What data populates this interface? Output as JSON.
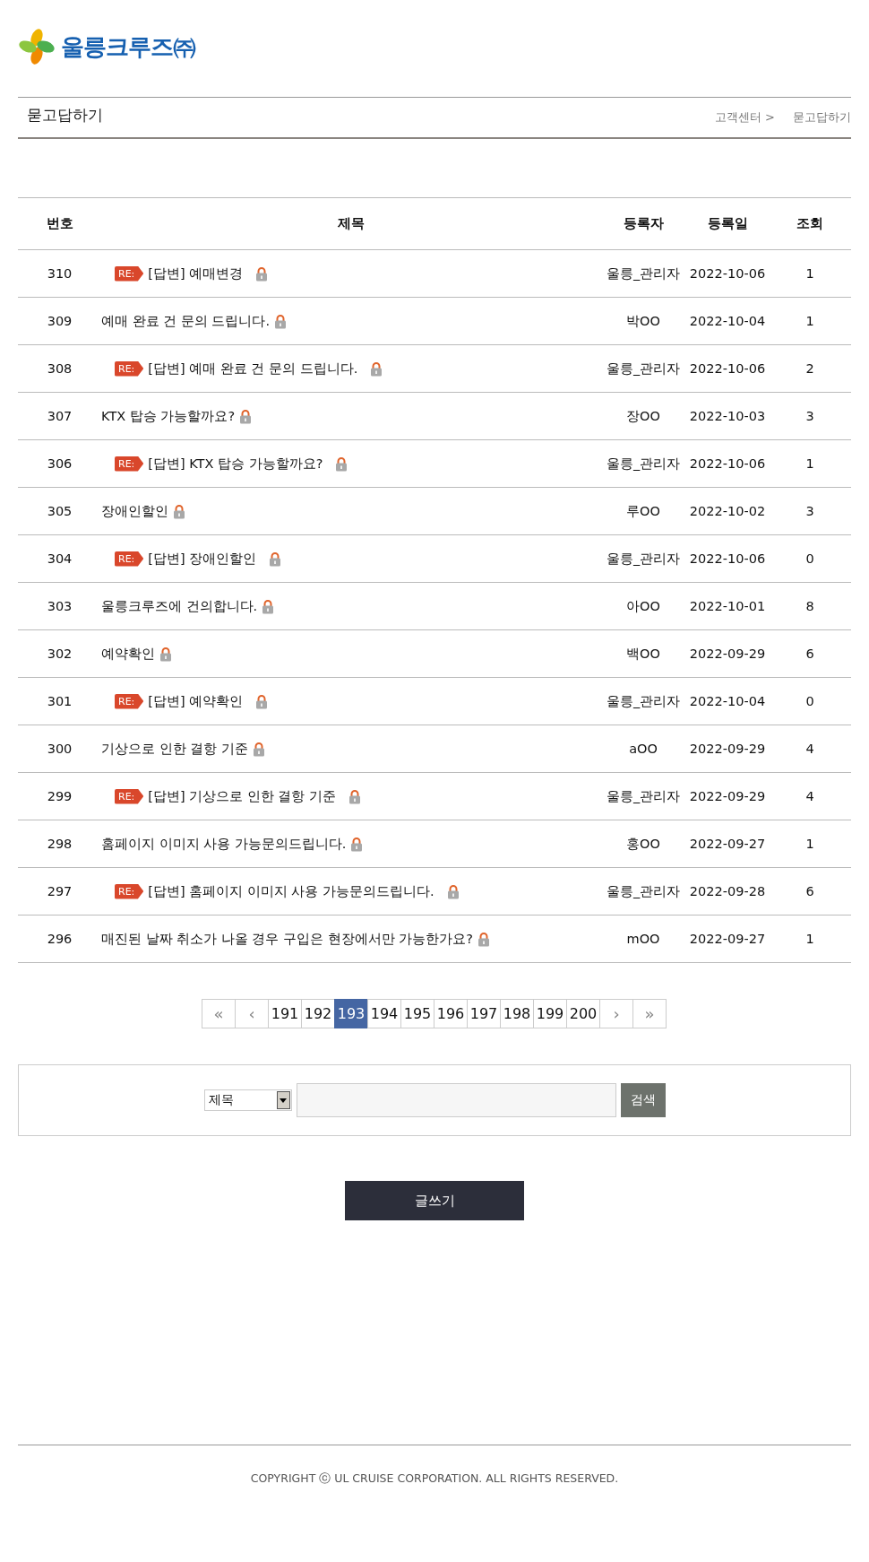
{
  "logo": {
    "text": "울릉크루즈㈜"
  },
  "page_header": {
    "title": "묻고답하기",
    "breadcrumb": [
      "고객센터 >",
      "묻고답하기"
    ]
  },
  "table": {
    "columns": [
      "번호",
      "제목",
      "등록자",
      "등록일",
      "조회"
    ],
    "rows": [
      {
        "number": "310",
        "kind": "reply",
        "badge": "RE:",
        "title": "[답변] 예매변경",
        "locked": true,
        "author": "울릉_관리자",
        "date": "2022-10-06",
        "views": "1"
      },
      {
        "number": "309",
        "kind": "question",
        "title": "예매 완료 건 문의 드립니다.",
        "locked": true,
        "author": "박OO",
        "date": "2022-10-04",
        "views": "1"
      },
      {
        "number": "308",
        "kind": "reply",
        "badge": "RE:",
        "title": "[답변] 예매 완료 건 문의 드립니다.",
        "locked": true,
        "author": "울릉_관리자",
        "date": "2022-10-06",
        "views": "2"
      },
      {
        "number": "307",
        "kind": "question",
        "title": "KTX 탑승 가능할까요?",
        "locked": true,
        "author": "장OO",
        "date": "2022-10-03",
        "views": "3"
      },
      {
        "number": "306",
        "kind": "reply",
        "badge": "RE:",
        "title": "[답변] KTX 탑승 가능할까요?",
        "locked": true,
        "author": "울릉_관리자",
        "date": "2022-10-06",
        "views": "1"
      },
      {
        "number": "305",
        "kind": "question",
        "title": "장애인할인",
        "locked": true,
        "author": "루OO",
        "date": "2022-10-02",
        "views": "3"
      },
      {
        "number": "304",
        "kind": "reply",
        "badge": "RE:",
        "title": "[답변] 장애인할인",
        "locked": true,
        "author": "울릉_관리자",
        "date": "2022-10-06",
        "views": "0"
      },
      {
        "number": "303",
        "kind": "question",
        "title": "울릉크루즈에 건의합니다.",
        "locked": true,
        "author": "아OO",
        "date": "2022-10-01",
        "views": "8"
      },
      {
        "number": "302",
        "kind": "question",
        "title": "예약확인",
        "locked": true,
        "author": "백OO",
        "date": "2022-09-29",
        "views": "6"
      },
      {
        "number": "301",
        "kind": "reply",
        "badge": "RE:",
        "title": "[답변] 예약확인",
        "locked": true,
        "author": "울릉_관리자",
        "date": "2022-10-04",
        "views": "0"
      },
      {
        "number": "300",
        "kind": "question",
        "title": "기상으로 인한 결항 기준",
        "locked": true,
        "author": "aOO",
        "date": "2022-09-29",
        "views": "4"
      },
      {
        "number": "299",
        "kind": "reply",
        "badge": "RE:",
        "title": "[답변] 기상으로 인한 결항 기준",
        "locked": true,
        "author": "울릉_관리자",
        "date": "2022-09-29",
        "views": "4"
      },
      {
        "number": "298",
        "kind": "question",
        "title": "홈페이지 이미지 사용 가능문의드립니다.",
        "locked": true,
        "author": "홍OO",
        "date": "2022-09-27",
        "views": "1"
      },
      {
        "number": "297",
        "kind": "reply",
        "badge": "RE:",
        "title": "[답변] 홈페이지 이미지 사용 가능문의드립니다.",
        "locked": true,
        "author": "울릉_관리자",
        "date": "2022-09-28",
        "views": "6"
      },
      {
        "number": "296",
        "kind": "question",
        "title": "매진된 날짜 취소가 나올 경우 구입은 현장에서만 가능한가요?",
        "locked": true,
        "author": "mOO",
        "date": "2022-09-27",
        "views": "1"
      }
    ]
  },
  "pagination": [
    {
      "label": "«",
      "kind": "nav",
      "selected": false
    },
    {
      "label": "‹",
      "kind": "nav",
      "selected": false
    },
    {
      "label": "191",
      "kind": "page",
      "selected": false
    },
    {
      "label": "192",
      "kind": "page",
      "selected": false
    },
    {
      "label": "193",
      "kind": "page",
      "selected": true
    },
    {
      "label": "194",
      "kind": "page",
      "selected": false
    },
    {
      "label": "195",
      "kind": "page",
      "selected": false
    },
    {
      "label": "196",
      "kind": "page",
      "selected": false
    },
    {
      "label": "197",
      "kind": "page",
      "selected": false
    },
    {
      "label": "198",
      "kind": "page",
      "selected": false
    },
    {
      "label": "199",
      "kind": "page",
      "selected": false
    },
    {
      "label": "200",
      "kind": "page",
      "selected": false
    },
    {
      "label": "›",
      "kind": "nav",
      "selected": false
    },
    {
      "label": "»",
      "kind": "nav",
      "selected": false
    }
  ],
  "search": {
    "field_select": "제목",
    "button": "검색"
  },
  "write_button": "글쓰기",
  "footer": {
    "copyright": "COPYRIGHT ⓒ UL CRUISE CORPORATION. ALL RIGHTS RESERVED."
  }
}
